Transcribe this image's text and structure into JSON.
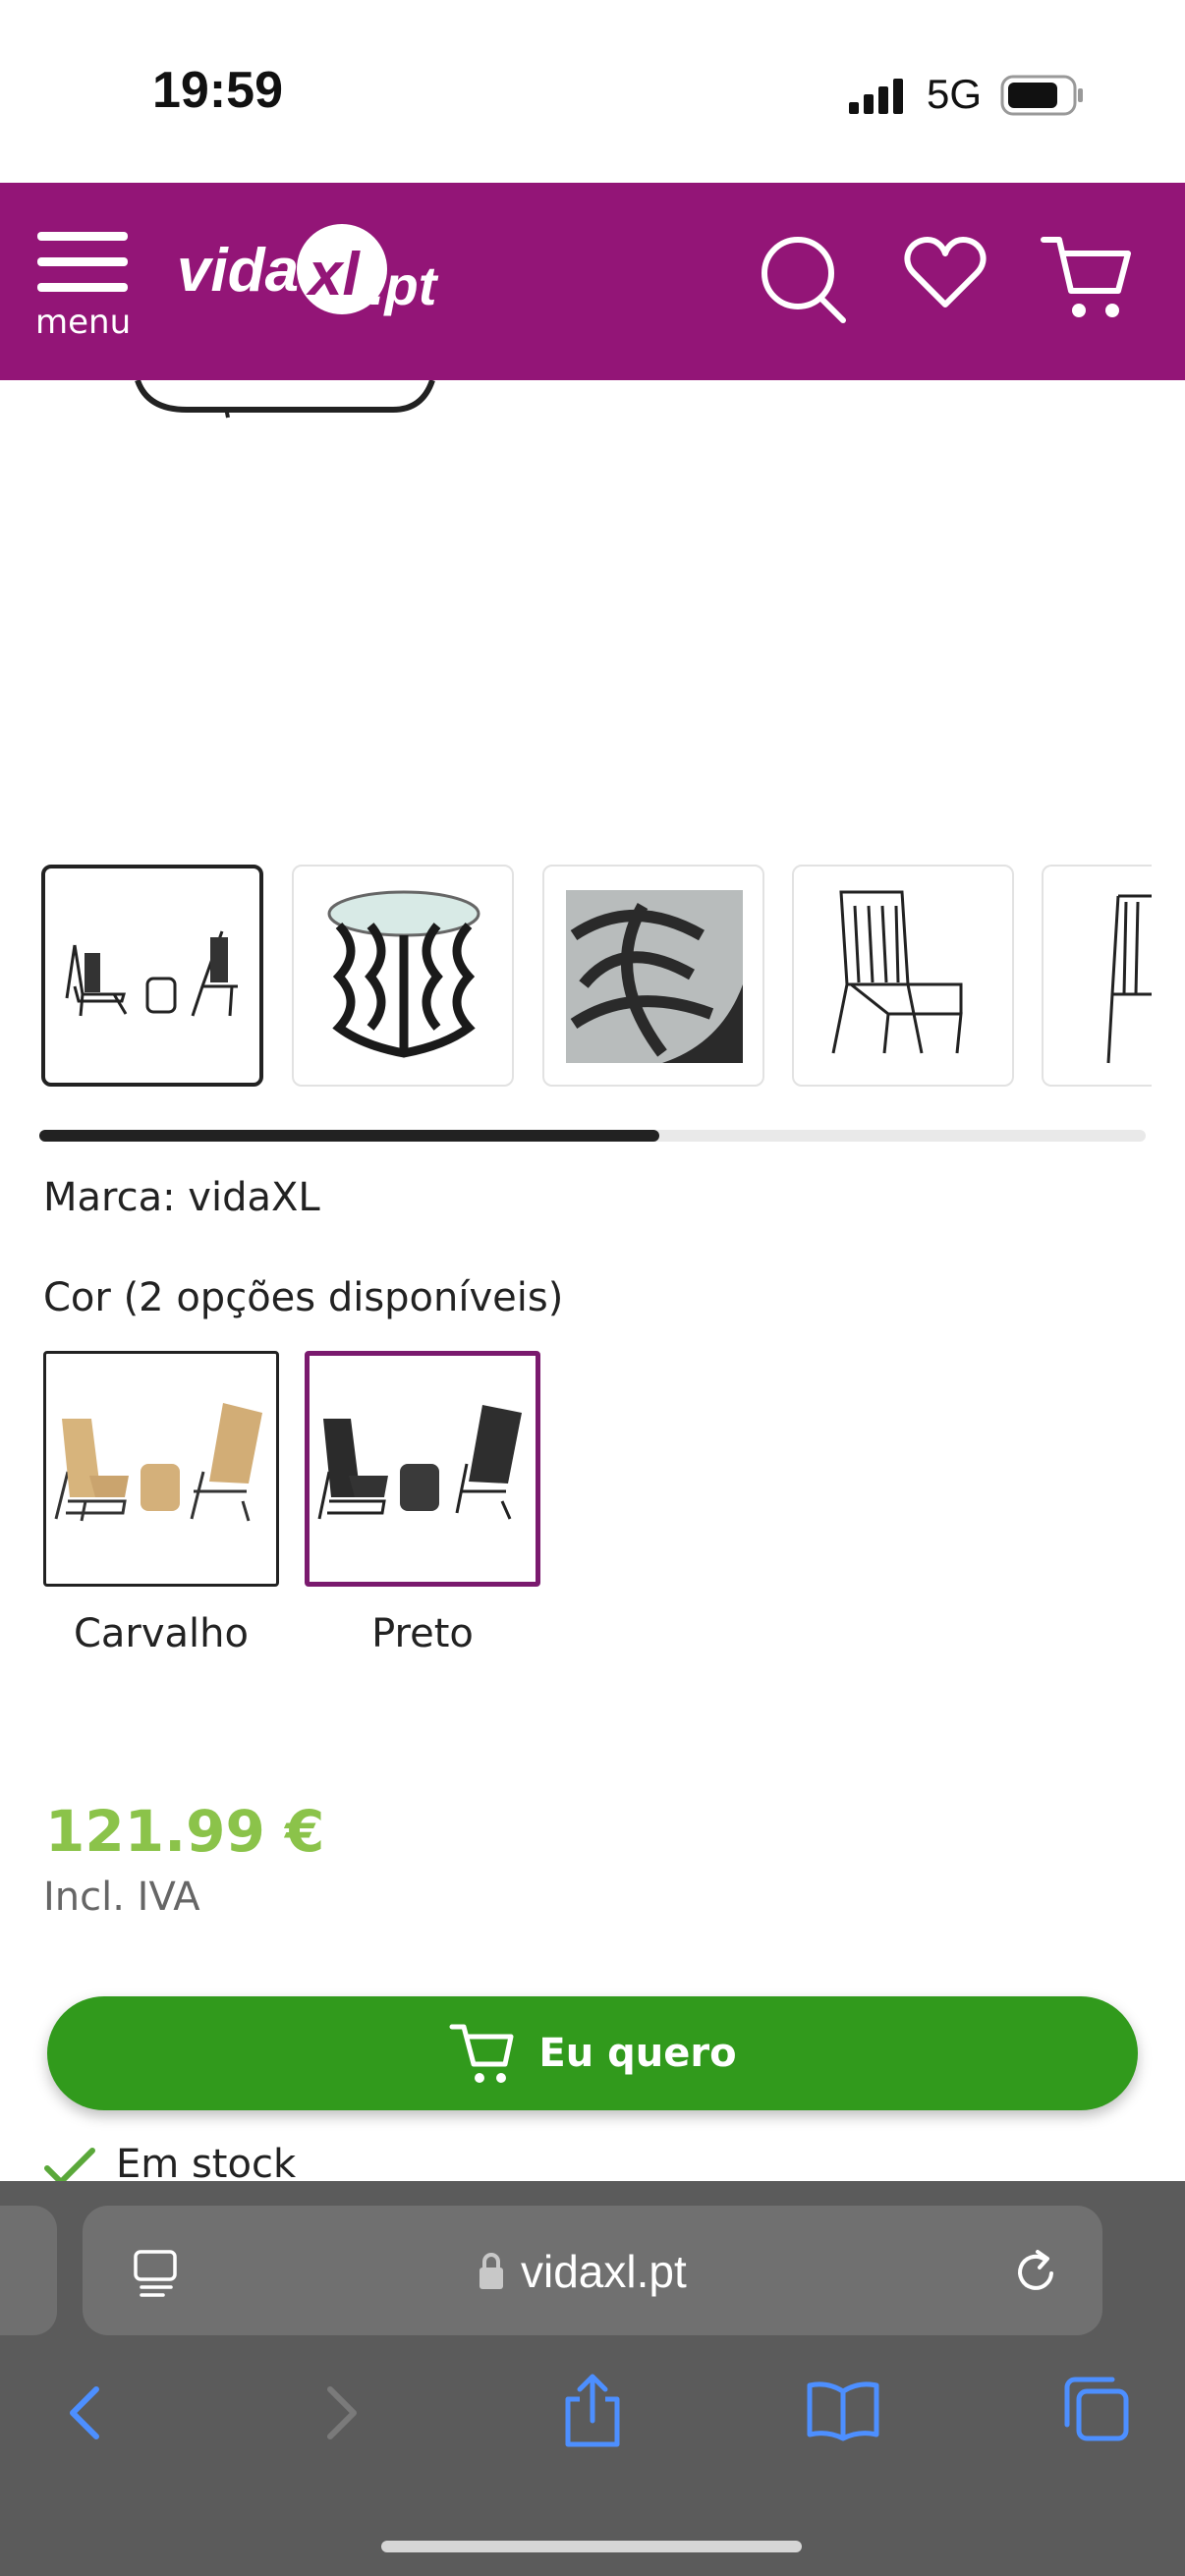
{
  "status_bar": {
    "time": "19:59",
    "network": "5G"
  },
  "header": {
    "menu_label": "menu",
    "logo_text": "vidaXL.pt",
    "bg_color": "#931577"
  },
  "thumbnails": [
    {
      "name": "set-thumbnail"
    },
    {
      "name": "table-thumbnail"
    },
    {
      "name": "table-detail-thumbnail"
    },
    {
      "name": "chair-thumbnail"
    },
    {
      "name": "chair-side-thumbnail"
    }
  ],
  "gallery": {
    "scroll_progress": 0.56
  },
  "product": {
    "brand": "Marca: vidaXL",
    "color_title": "Cor (2 opções disponíveis)",
    "color_options": [
      {
        "label": "Carvalho",
        "selected": false
      },
      {
        "label": "Preto",
        "selected": true
      }
    ],
    "price": "121.99 €",
    "vat": "Incl. IVA",
    "buy_label": "Eu quero",
    "stock": "Em stock"
  },
  "browser": {
    "url": "vidaxl.pt"
  },
  "colors": {
    "price": "#8bc34a",
    "buy_button": "#319a1c",
    "selected_border": "#7a1a6e"
  }
}
